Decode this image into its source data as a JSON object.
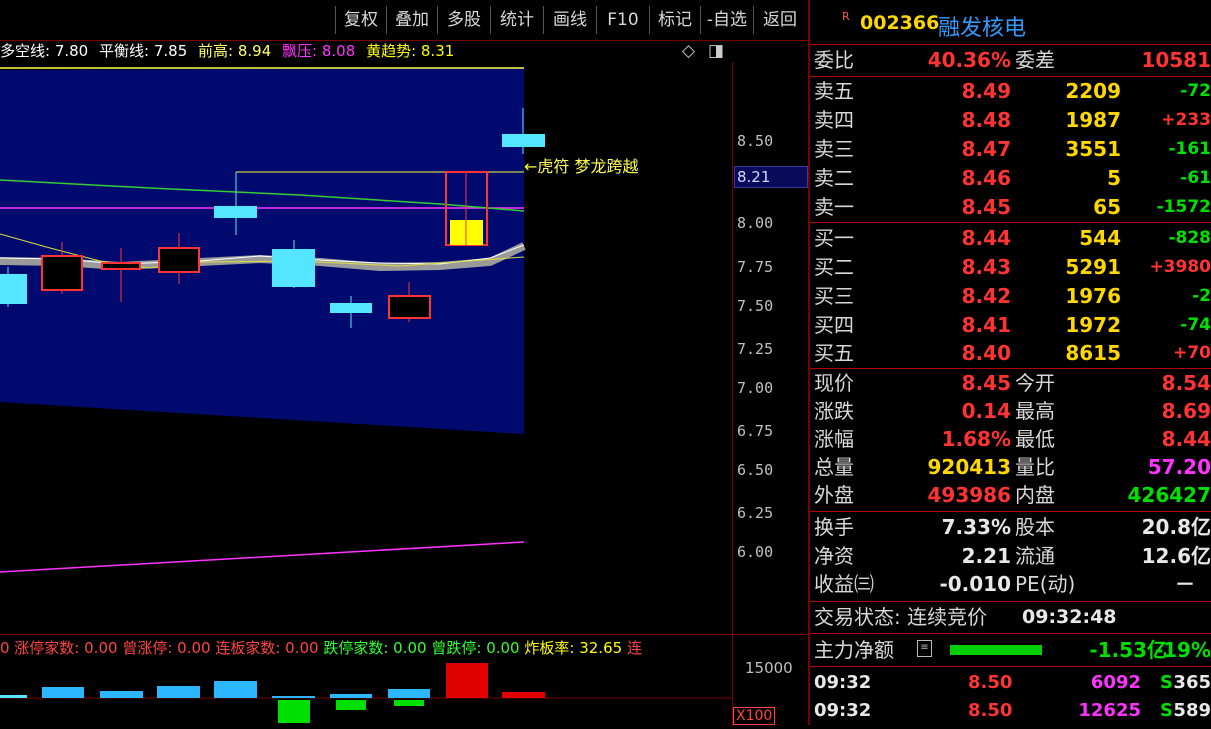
{
  "toolbar": {
    "buttons": [
      "复权",
      "叠加",
      "多股",
      "统计",
      "画线",
      "F10",
      "标记",
      "-自选",
      "返回"
    ]
  },
  "indicator": {
    "items": [
      {
        "text": "多空线: 7.80",
        "color": "#ffffff"
      },
      {
        "text": "平衡线: 7.85",
        "color": "#ffffff"
      },
      {
        "text": "前高: 8.94",
        "color": "#ffff66"
      },
      {
        "text": "飘压: 8.08",
        "color": "#ff33ff"
      },
      {
        "text": "黄趋势: 8.31",
        "color": "#ffff00"
      }
    ],
    "diamond_icon": "◇",
    "panel_icon": "◨"
  },
  "chart": {
    "annotation": "←虎符 梦龙跨越",
    "price_labels": [
      "8.50",
      "8.25",
      "8.00",
      "7.75",
      "7.50",
      "7.25",
      "7.00",
      "6.75",
      "6.50",
      "6.25",
      "6.00"
    ],
    "current_price_tag": "8.21"
  },
  "stats_bar": {
    "items": [
      {
        "text": "0 涨停家数: 0.00",
        "color": "#ff4444"
      },
      {
        "text": "曾涨停: 0.00",
        "color": "#ff4444"
      },
      {
        "text": "连板家数: 0.00",
        "color": "#ff4444"
      },
      {
        "text": "跌停家数: 0.00",
        "color": "#33ff33"
      },
      {
        "text": "曾跌停: 0.00",
        "color": "#33ff33"
      },
      {
        "text": "炸板率: 32.65",
        "color": "#ffff00"
      },
      {
        "text": "连",
        "color": "#ff4444"
      }
    ]
  },
  "volume_axis": {
    "top": "15000",
    "unit": "X100"
  },
  "stock": {
    "marker": "R",
    "code": "002366",
    "name": "融发核电"
  },
  "order_ratio": {
    "label1": "委比",
    "value1": "40.36%",
    "label2": "委差",
    "value2": "10581"
  },
  "asks": [
    {
      "label": "卖五",
      "price": "8.49",
      "vol": "2209",
      "chg": "-72"
    },
    {
      "label": "卖四",
      "price": "8.48",
      "vol": "1987",
      "chg": "+233"
    },
    {
      "label": "卖三",
      "price": "8.47",
      "vol": "3551",
      "chg": "-161"
    },
    {
      "label": "卖二",
      "price": "8.46",
      "vol": "5",
      "chg": "-61"
    },
    {
      "label": "卖一",
      "price": "8.45",
      "vol": "65",
      "chg": "-1572"
    }
  ],
  "bids": [
    {
      "label": "买一",
      "price": "8.44",
      "vol": "544",
      "chg": "-828"
    },
    {
      "label": "买二",
      "price": "8.43",
      "vol": "5291",
      "chg": "+3980"
    },
    {
      "label": "买三",
      "price": "8.42",
      "vol": "1976",
      "chg": "-2"
    },
    {
      "label": "买四",
      "price": "8.41",
      "vol": "1972",
      "chg": "-74"
    },
    {
      "label": "买五",
      "price": "8.40",
      "vol": "8615",
      "chg": "+70"
    }
  ],
  "quote": [
    {
      "l1": "现价",
      "v1": "8.45",
      "c1": "red",
      "l2": "今开",
      "v2": "8.54",
      "c2": "red"
    },
    {
      "l1": "涨跌",
      "v1": "0.14",
      "c1": "red",
      "l2": "最高",
      "v2": "8.69",
      "c2": "red"
    },
    {
      "l1": "涨幅",
      "v1": "1.68%",
      "c1": "red",
      "l2": "最低",
      "v2": "8.44",
      "c2": "red"
    },
    {
      "l1": "总量",
      "v1": "920413",
      "c1": "yellow",
      "l2": "量比",
      "v2": "57.20",
      "c2": "magenta"
    },
    {
      "l1": "外盘",
      "v1": "493986",
      "c1": "red",
      "l2": "内盘",
      "v2": "426427",
      "c2": "green"
    }
  ],
  "fundamentals": [
    {
      "l1": "换手",
      "v1": "7.33%",
      "l2": "股本",
      "v2": "20.8亿"
    },
    {
      "l1": "净资",
      "v1": "2.21",
      "l2": "流通",
      "v2": "12.6亿"
    },
    {
      "l1": "收益㈢",
      "v1": "-0.010",
      "l2": "PE(动)",
      "v2": "－"
    }
  ],
  "trade_status": {
    "label": "交易状态: 连续竞价",
    "time": "09:32:48"
  },
  "main_flow": {
    "label": "主力净额",
    "value": "-1.53亿",
    "pct": "-19%"
  },
  "ticks": [
    {
      "time": "09:32",
      "price": "8.50",
      "vol": "6092",
      "side": "S",
      "num": "365"
    },
    {
      "time": "09:32",
      "price": "8.50",
      "vol": "12625",
      "side": "S",
      "num": "589"
    }
  ]
}
